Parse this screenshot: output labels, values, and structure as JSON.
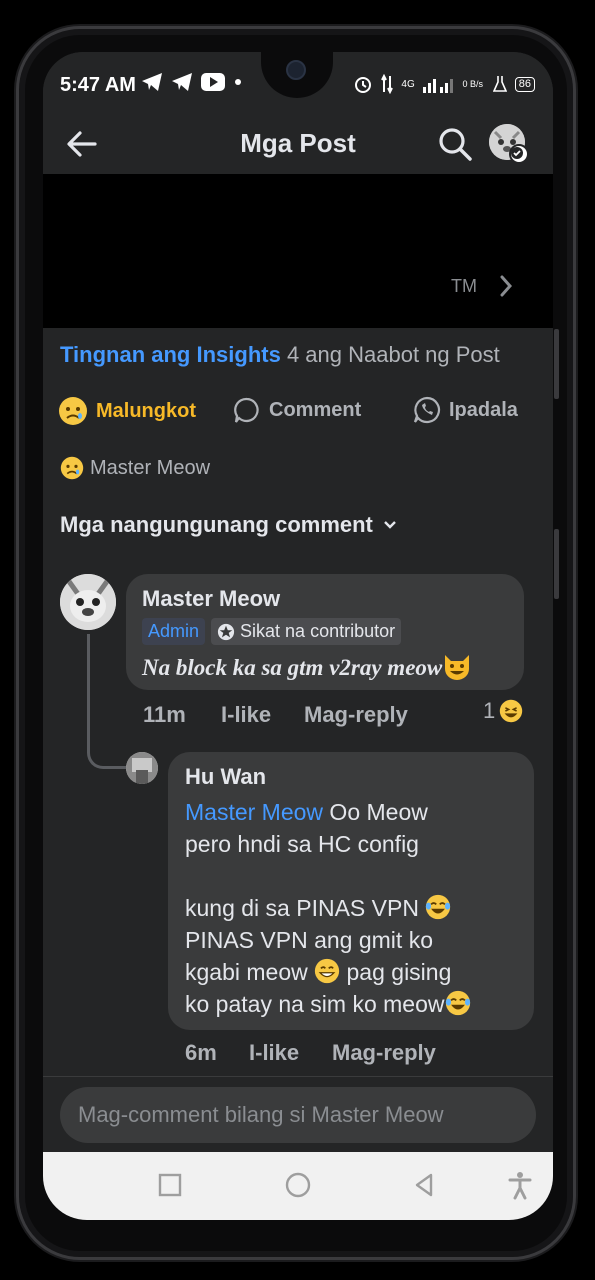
{
  "status": {
    "time": "5:47 AM",
    "net_speed": "0 B/s",
    "network": "4G",
    "battery": "86"
  },
  "header": {
    "title": "Mga Post"
  },
  "media": {
    "tm": "TM"
  },
  "insights": {
    "link": "Tingnan ang Insights",
    "reach": "4 ang Naabot ng Post"
  },
  "actions": {
    "react_label": "Malungkot",
    "comment_label": "Comment",
    "send_label": "Ipadala"
  },
  "reactors": {
    "name": "Master Meow"
  },
  "comments_sort": {
    "label": "Mga nangungunang comment"
  },
  "comments": [
    {
      "author": "Master Meow",
      "badges": [
        "Admin",
        "Sikat na contributor"
      ],
      "text": "Na block ka sa gtm v2ray meow",
      "time": "11m",
      "like": "I-like",
      "reply": "Mag-reply",
      "reaction_count": "1"
    },
    {
      "author": "Hu Wan",
      "mention": "Master Meow",
      "line1": " Oo Meow",
      "line2": "pero hndi sa HC config",
      "line3": "kung di sa PINAS VPN ",
      "line4": "PINAS VPN ang gmit ko",
      "line5": "kgabi meow ",
      "line5b": " pag gising",
      "line6": "ko  patay na sim ko meow",
      "time": "6m",
      "like": "I-like",
      "reply": "Mag-reply"
    }
  ],
  "composer": {
    "placeholder": "Mag-comment bilang si Master Meow"
  }
}
